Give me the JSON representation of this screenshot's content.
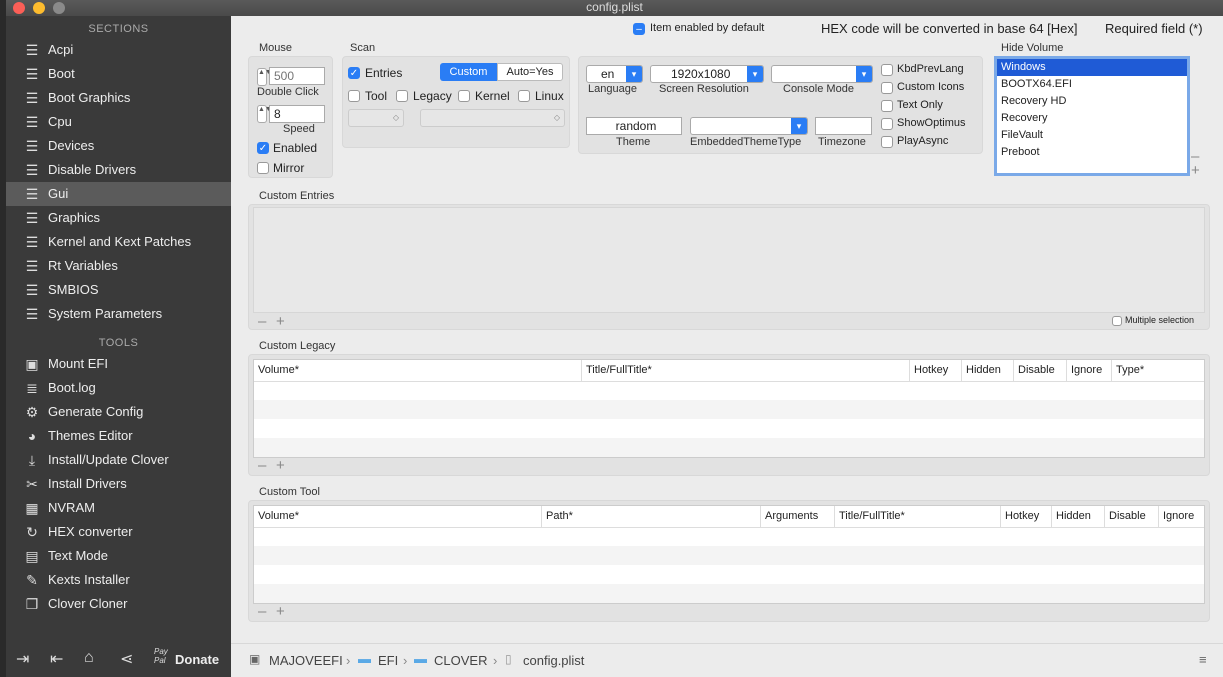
{
  "window_title": "config.plist",
  "colors": {
    "accent": "#2a7df5",
    "sidebar_bg": "#3a3a3a",
    "selection": "#1f5bd6"
  },
  "sidebar": {
    "sections_header": "SECTIONS",
    "sections": [
      {
        "label": "Acpi",
        "icon": "list-icon"
      },
      {
        "label": "Boot",
        "icon": "list-icon"
      },
      {
        "label": "Boot Graphics",
        "icon": "list-icon"
      },
      {
        "label": "Cpu",
        "icon": "list-icon"
      },
      {
        "label": "Devices",
        "icon": "list-icon"
      },
      {
        "label": "Disable Drivers",
        "icon": "list-icon"
      },
      {
        "label": "Gui",
        "icon": "list-icon",
        "selected": true
      },
      {
        "label": "Graphics",
        "icon": "list-icon"
      },
      {
        "label": "Kernel and Kext Patches",
        "icon": "list-icon"
      },
      {
        "label": "Rt Variables",
        "icon": "list-icon"
      },
      {
        "label": "SMBIOS",
        "icon": "list-icon"
      },
      {
        "label": "System Parameters",
        "icon": "list-icon"
      }
    ],
    "tools_header": "TOOLS",
    "tools": [
      {
        "label": "Mount EFI",
        "icon": "disk-icon"
      },
      {
        "label": "Boot.log",
        "icon": "log-icon"
      },
      {
        "label": "Generate Config",
        "icon": "gears-icon"
      },
      {
        "label": "Themes Editor",
        "icon": "palette-icon"
      },
      {
        "label": "Install/Update Clover",
        "icon": "download-icon"
      },
      {
        "label": "Install Drivers",
        "icon": "tools-icon"
      },
      {
        "label": "NVRAM",
        "icon": "chip-icon"
      },
      {
        "label": "HEX converter",
        "icon": "refresh-icon"
      },
      {
        "label": "Text Mode",
        "icon": "text-icon"
      },
      {
        "label": "Kexts Installer",
        "icon": "plug-icon"
      },
      {
        "label": "Clover Cloner",
        "icon": "clone-icon"
      }
    ],
    "bottom": {
      "donate_label": "Donate",
      "paypal_label": "Pay Pal"
    }
  },
  "header": {
    "item_enabled_label": "Item enabled by default",
    "hex_note": "HEX code will be converted in base 64 [Hex]",
    "required_note": "Required field (*)"
  },
  "mouse": {
    "title": "Mouse",
    "double_click_value": "",
    "double_click_placeholder": "500",
    "double_click_label": "Double Click",
    "speed_value": "8",
    "speed_label": "Speed",
    "enabled_label": "Enabled",
    "enabled": true,
    "mirror_label": "Mirror",
    "mirror": false
  },
  "scan": {
    "title": "Scan",
    "entries_label": "Entries",
    "entries": true,
    "custom_label": "Custom",
    "autoyes_label": "Auto=Yes",
    "tool_label": "Tool",
    "legacy_label": "Legacy",
    "kernel_label": "Kernel",
    "linux_label": "Linux"
  },
  "gui": {
    "language_value": "en",
    "language_label": "Language",
    "resolution_value": "1920x1080",
    "resolution_label": "Screen Resolution",
    "console_value": "",
    "console_label": "Console Mode",
    "theme_value": "random",
    "theme_label": "Theme",
    "embedded_value": "",
    "embedded_label": "EmbeddedThemeType",
    "timezone_value": "",
    "timezone_label": "Timezone",
    "options": [
      {
        "label": "KbdPrevLang",
        "checked": false
      },
      {
        "label": "Custom Icons",
        "checked": false
      },
      {
        "label": "Text Only",
        "checked": false
      },
      {
        "label": "ShowOptimus",
        "checked": false
      },
      {
        "label": "PlayAsync",
        "checked": false
      }
    ]
  },
  "hide_volume": {
    "title": "Hide Volume",
    "items": [
      {
        "label": "Windows",
        "selected": true
      },
      {
        "label": "BOOTX64.EFI"
      },
      {
        "label": "Recovery HD"
      },
      {
        "label": "Recovery"
      },
      {
        "label": "FileVault"
      },
      {
        "label": "Preboot"
      }
    ]
  },
  "custom_entries": {
    "title": "Custom Entries",
    "multiple_selection_label": "Multiple selection"
  },
  "custom_legacy": {
    "title": "Custom Legacy",
    "columns": [
      "Volume*",
      "Title/FullTitle*",
      "Hotkey",
      "Hidden",
      "Disable",
      "Ignore",
      "Type*"
    ]
  },
  "custom_tool": {
    "title": "Custom Tool",
    "columns": [
      "Volume*",
      "Path*",
      "Arguments",
      "Title/FullTitle*",
      "Hotkey",
      "Hidden",
      "Disable",
      "Ignore"
    ]
  },
  "pathbar": {
    "segments": [
      "MAJOVEEFI",
      "EFI",
      "CLOVER",
      "config.plist"
    ]
  }
}
